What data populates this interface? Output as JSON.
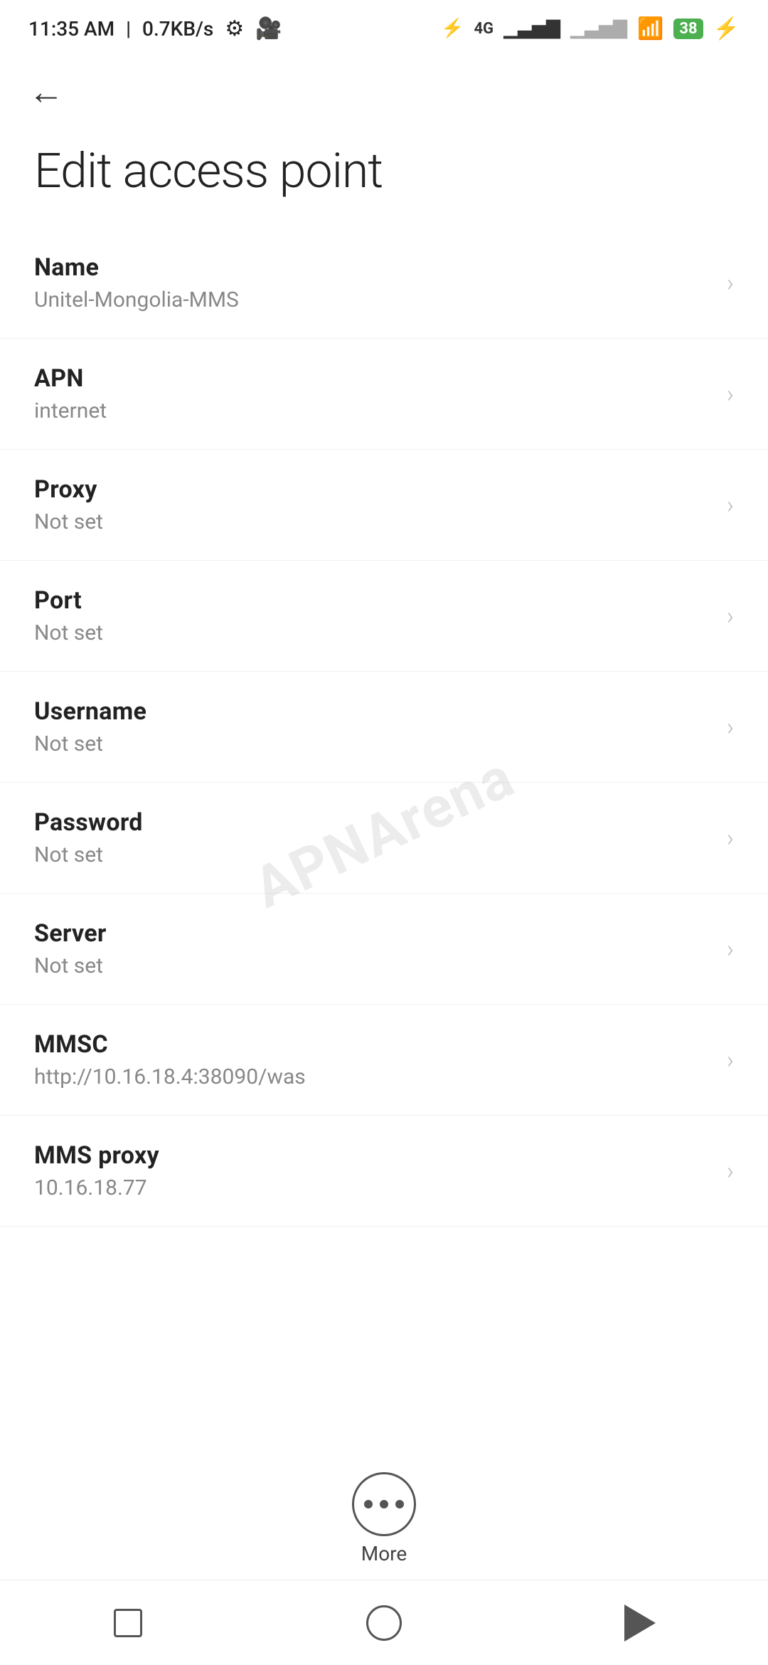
{
  "statusBar": {
    "time": "11:35 AM",
    "speed": "0.7KB/s"
  },
  "page": {
    "title": "Edit access point",
    "backLabel": "←"
  },
  "settings": [
    {
      "id": "name",
      "label": "Name",
      "value": "Unitel-Mongolia-MMS"
    },
    {
      "id": "apn",
      "label": "APN",
      "value": "internet"
    },
    {
      "id": "proxy",
      "label": "Proxy",
      "value": "Not set"
    },
    {
      "id": "port",
      "label": "Port",
      "value": "Not set"
    },
    {
      "id": "username",
      "label": "Username",
      "value": "Not set"
    },
    {
      "id": "password",
      "label": "Password",
      "value": "Not set"
    },
    {
      "id": "server",
      "label": "Server",
      "value": "Not set"
    },
    {
      "id": "mmsc",
      "label": "MMSC",
      "value": "http://10.16.18.4:38090/was"
    },
    {
      "id": "mms-proxy",
      "label": "MMS proxy",
      "value": "10.16.18.77"
    }
  ],
  "more": {
    "label": "More"
  },
  "watermark": "APNArena"
}
